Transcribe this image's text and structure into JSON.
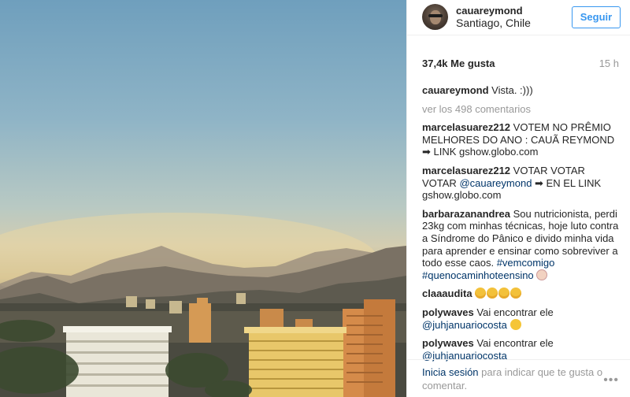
{
  "post": {
    "username": "cauareymond",
    "location": "Santiago, Chile",
    "follow_label": "Seguir",
    "likes": "37,4k Me gusta",
    "time": "15 h",
    "caption_user": "cauareymond",
    "caption_text": "Vista. :)))",
    "more_comments": "ver los 498 comentarios"
  },
  "comments": [
    {
      "user": "marcelasuarez212",
      "text": "VOTEM NO PRÊMIO MELHORES DO ANO : CAUÃ REYMOND ➡ LINK gshow.globo.com"
    },
    {
      "user": "marcelasuarez212",
      "text_a": "VOTAR VOTAR VOTAR",
      "mention": "@cauareymond",
      "text_b": "➡ EN EL LINK gshow.globo.com"
    },
    {
      "user": "barbarazanandrea",
      "text": "Sou nutricionista, perdi 23kg com minhas técnicas, hoje luto contra a Síndrome do Pânico e divido minha vida para aprender e ensinar como sobreviver a todo esse caos.",
      "tag1": "#vemcomigo",
      "tag2": "#quenocaminhoteensino"
    },
    {
      "user": "claaaudita",
      "emoji_icon": "scream-emoji"
    },
    {
      "user": "polywaves",
      "text": "Vai encontrar ele",
      "mention": "@juhjanuariocosta"
    },
    {
      "user": "polywaves",
      "text": "Vai encontrar ele",
      "mention": "@juhjanuariocosta"
    }
  ],
  "footer": {
    "login_label": "Inicia sesión",
    "text": "para indicar que te gusta o comentar.",
    "more_icon": "more-options-icon",
    "dots": "•••"
  },
  "colors": {
    "accent": "#3897f0",
    "link": "#003569",
    "muted": "#999999",
    "text": "#262626"
  }
}
